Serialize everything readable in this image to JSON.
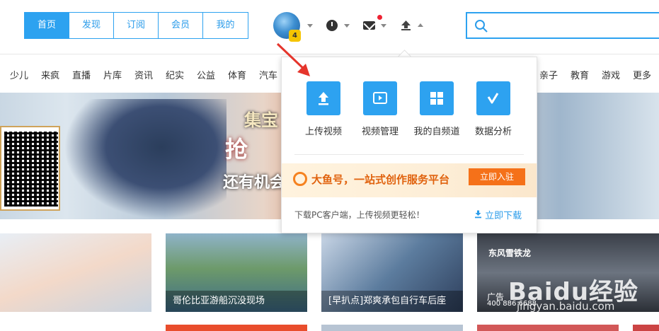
{
  "header": {
    "tabs": [
      {
        "label": "首页",
        "active": true
      },
      {
        "label": "发现",
        "active": false
      },
      {
        "label": "订阅",
        "active": false
      },
      {
        "label": "会员",
        "active": false
      },
      {
        "label": "我的",
        "active": false
      }
    ],
    "avatar_badge": "4",
    "search": {
      "placeholder": ""
    }
  },
  "categories": [
    "少儿",
    "来疯",
    "直播",
    "片库",
    "资讯",
    "纪实",
    "公益",
    "体育",
    "汽车",
    "亲子",
    "教育",
    "游戏",
    "更多"
  ],
  "banner": {
    "title": "集宝",
    "big": "抢",
    "sub": "还有机会"
  },
  "upload_menu": {
    "tools": [
      {
        "label": "上传视频",
        "icon": "upload-icon"
      },
      {
        "label": "视频管理",
        "icon": "video-manage-icon"
      },
      {
        "label": "我的自频道",
        "icon": "channel-icon"
      },
      {
        "label": "数据分析",
        "icon": "analytics-icon"
      }
    ],
    "promo_text": "大鱼号，一站式创作服务平台",
    "promo_button": "立即入驻",
    "footer_text": "下载PC客户端，上传视频更轻松！",
    "download_link": "立即下载"
  },
  "thumbnails": [
    {
      "caption": ""
    },
    {
      "caption": "哥伦比亚游船沉没现场"
    },
    {
      "caption": "[早扒点]郑爽承包自行车后座"
    },
    {
      "caption": "",
      "ad_label": "广告",
      "ad_phone": "400 886 6688",
      "ad_brand": "东风雪铁龙"
    }
  ],
  "watermark": {
    "text": "Baidu经验",
    "url": "jingyan.baidu.com"
  },
  "colors": {
    "accent": "#2da2f0",
    "promo_orange": "#f57119",
    "notify_red": "#e22233"
  }
}
